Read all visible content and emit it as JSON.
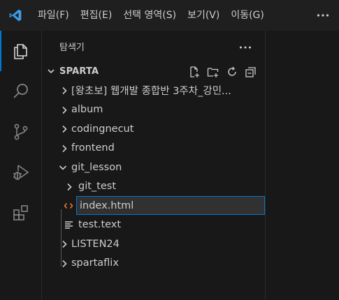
{
  "menu": {
    "items": [
      "파일(F)",
      "편집(E)",
      "선택 영역(S)",
      "보기(V)",
      "이동(G)"
    ],
    "more_icon": "ellipsis-icon"
  },
  "activity_bar": {
    "items": [
      "explorer-icon",
      "search-icon",
      "source-control-icon",
      "run-debug-icon",
      "extensions-icon"
    ],
    "active": "explorer-icon",
    "accent": "#0078d4"
  },
  "sidebar": {
    "title": "탐색기",
    "section": {
      "title": "SPARTA",
      "actions": [
        "new-file-icon",
        "new-folder-icon",
        "refresh-icon",
        "collapse-all-icon"
      ]
    },
    "tree": [
      {
        "label": "[왕초보] 웹개발 종합반 3주차_강민...",
        "type": "folder",
        "expanded": false,
        "depth": 0
      },
      {
        "label": "album",
        "type": "folder",
        "expanded": false,
        "depth": 0
      },
      {
        "label": "codingnecut",
        "type": "folder",
        "expanded": false,
        "depth": 0
      },
      {
        "label": "frontend",
        "type": "folder",
        "expanded": false,
        "depth": 0
      },
      {
        "label": "git_lesson",
        "type": "folder",
        "expanded": true,
        "depth": 0
      },
      {
        "label": "git_test",
        "type": "folder",
        "expanded": false,
        "depth": 1
      },
      {
        "label": "",
        "type": "html-file",
        "depth": 1,
        "editing": true
      },
      {
        "label": "test.text",
        "type": "text-file",
        "depth": 1
      },
      {
        "label": "LISTEN24",
        "type": "folder",
        "expanded": false,
        "depth": 0
      },
      {
        "label": "spartaflix",
        "type": "folder",
        "expanded": false,
        "depth": 0
      }
    ],
    "rename_input": {
      "value": "index.html"
    }
  },
  "colors": {
    "background": "#181818",
    "titlebar": "#1f1f1f",
    "text": "#cccccc",
    "focus_border": "#0078d4",
    "html_icon": "#e37933"
  }
}
